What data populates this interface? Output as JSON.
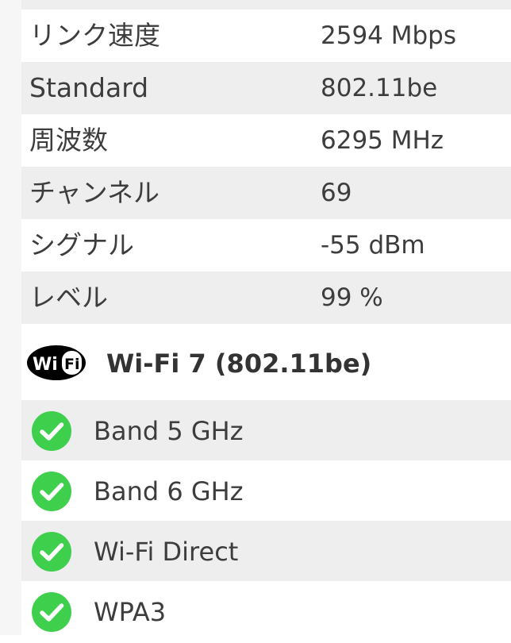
{
  "network_info": {
    "rows": [
      {
        "label": "リンク速度",
        "value": "2594 Mbps"
      },
      {
        "label": "Standard",
        "value": "802.11be"
      },
      {
        "label": "周波数",
        "value": "6295 MHz"
      },
      {
        "label": "チャンネル",
        "value": "69"
      },
      {
        "label": "シグナル",
        "value": "-55 dBm"
      },
      {
        "label": "レベル",
        "value": "99 %"
      }
    ]
  },
  "wifi_section": {
    "logo_icon": "wifi-logo-icon",
    "logo_text_left": "Wi",
    "logo_text_right": "Fi",
    "title": "Wi-Fi 7 (802.11be)"
  },
  "features": {
    "icon": "check-circle-icon",
    "check_color": "#3ecf4d",
    "items": [
      {
        "label": "Band 5 GHz",
        "supported": true
      },
      {
        "label": "Band 6 GHz",
        "supported": true
      },
      {
        "label": "Wi-Fi Direct",
        "supported": true
      },
      {
        "label": "WPA3",
        "supported": true
      }
    ]
  }
}
